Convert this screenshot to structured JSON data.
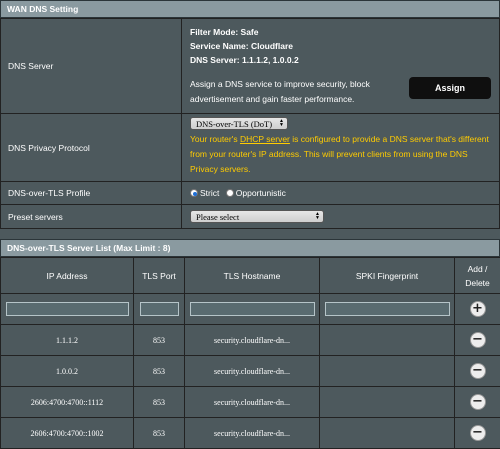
{
  "wan_dns": {
    "header": "WAN DNS Setting",
    "dns_server_label": "DNS Server",
    "filter_mode": "Filter Mode: Safe",
    "service_name": "Service Name: Cloudflare",
    "dns_server_value": "DNS Server: 1.1.1.2, 1.0.0.2",
    "description": "Assign a DNS service to improve security, block advertisement and gain faster performance.",
    "assign_label": "Assign",
    "privacy_label": "DNS Privacy Protocol",
    "privacy_value": "DNS-over-TLS (DoT)",
    "warn_prefix": "Your router's ",
    "warn_link": "DHCP server",
    "warn_suffix": " is configured to provide a DNS server that's different from your router's IP address. This will prevent clients from using the DNS Privacy servers.",
    "profile_label": "DNS-over-TLS Profile",
    "profile_strict": "Strict",
    "profile_opportunistic": "Opportunistic",
    "preset_label": "Preset servers",
    "preset_value": "Please select"
  },
  "server_list": {
    "header": "DNS-over-TLS Server List (Max Limit : 8)",
    "columns": [
      "IP Address",
      "TLS Port",
      "TLS Hostname",
      "SPKI Fingerprint",
      "Add / Delete"
    ],
    "rows": [
      {
        "ip": "1.1.1.2",
        "port": "853",
        "host": "security.cloudflare-dn..."
      },
      {
        "ip": "1.0.0.2",
        "port": "853",
        "host": "security.cloudflare-dn..."
      },
      {
        "ip": "2606:4700:4700::1112",
        "port": "853",
        "host": "security.cloudflare-dn..."
      },
      {
        "ip": "2606:4700:4700::1002",
        "port": "853",
        "host": "security.cloudflare-dn..."
      }
    ]
  },
  "icons": {
    "add": "plus-circle-icon",
    "delete": "minus-circle-icon"
  }
}
